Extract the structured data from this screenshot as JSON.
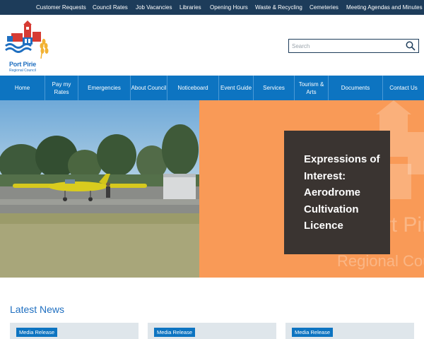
{
  "topbar": {
    "links": [
      "Customer Requests",
      "Council Rates",
      "Job Vacancies",
      "Libraries",
      "Opening Hours",
      "Waste & Recycling",
      "Cemeteries",
      "Meeting Agendas and Minutes"
    ]
  },
  "logo": {
    "name": "Port Pirie",
    "subtitle": "Regional Council"
  },
  "search": {
    "placeholder": "Search",
    "value": ""
  },
  "nav": {
    "items": [
      "Home",
      "Pay my Rates",
      "Emergencies",
      "About Council",
      "Noticeboard",
      "Event Guide",
      "Services",
      "Tourism & Arts",
      "Documents",
      "Contact Us"
    ]
  },
  "hero": {
    "caption": "Expressions of Interest: Aerodrome Cultivation Licence",
    "watermark_line1": "Port Pirie",
    "watermark_line2": "Regional Council"
  },
  "news": {
    "heading": "Latest News",
    "cards": [
      {
        "badge": "Media Release"
      },
      {
        "badge": "Media Release"
      },
      {
        "badge": "Media Release"
      }
    ]
  },
  "colors": {
    "topbar": "#1d3c5a",
    "nav": "#0d74c1",
    "hero_orange": "#f99a57",
    "caption_bg": "#3a3431",
    "heading_blue": "#1f6fc0"
  }
}
